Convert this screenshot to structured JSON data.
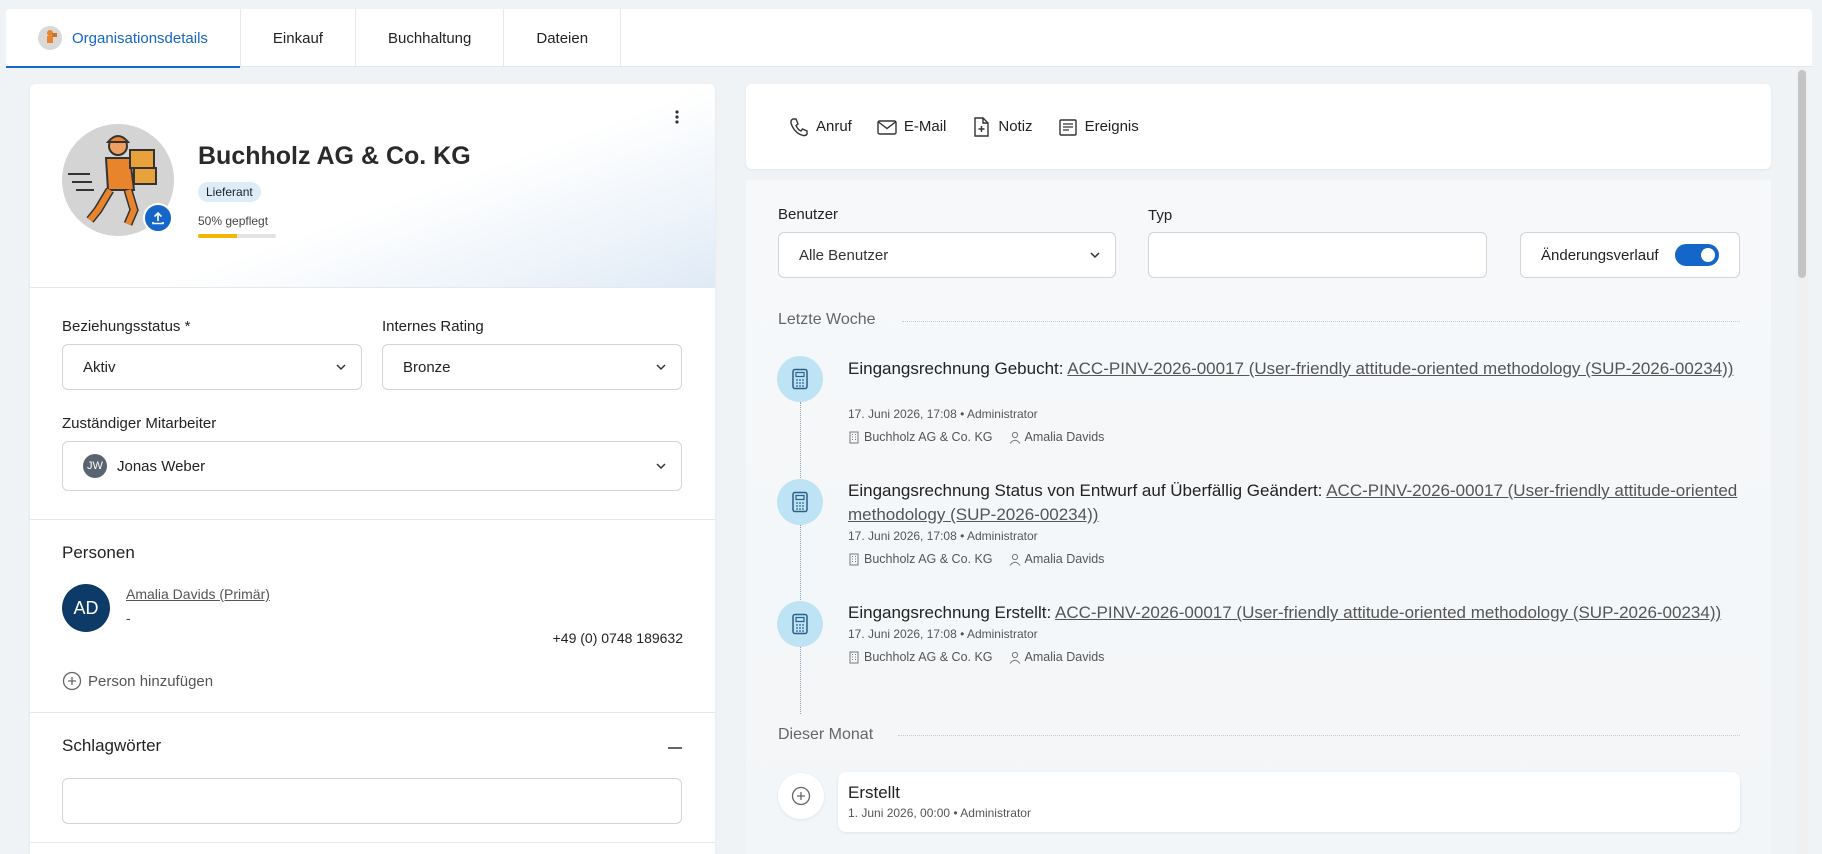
{
  "tabs": [
    {
      "label": "Organisationsdetails"
    },
    {
      "label": "Einkauf"
    },
    {
      "label": "Buchhaltung"
    },
    {
      "label": "Dateien"
    }
  ],
  "org": {
    "name": "Buchholz AG & Co. KG",
    "badge": "Lieferant",
    "care_text": "50% gepflegt",
    "care_fraction": 0.5
  },
  "fields": {
    "relationship_label": "Beziehungsstatus *",
    "relationship_value": "Aktiv",
    "rating_label": "Internes Rating",
    "rating_value": "Bronze",
    "owner_label": "Zuständiger Mitarbeiter",
    "owner_initials": "JW",
    "owner_value": "Jonas Weber"
  },
  "persons": {
    "title": "Personen",
    "initials": "AD",
    "name": "Amalia Davids (Primär)",
    "sub": "-",
    "phone": "+49 (0) 0748 189632",
    "add_label": "Person hinzufügen"
  },
  "tags": {
    "title": "Schlagwörter"
  },
  "actions": [
    {
      "label": "Anruf",
      "icon": "phone-icon"
    },
    {
      "label": "E-Mail",
      "icon": "mail-icon"
    },
    {
      "label": "Notiz",
      "icon": "note-icon"
    },
    {
      "label": "Ereignis",
      "icon": "event-icon"
    }
  ],
  "filters": {
    "user_label": "Benutzer",
    "user_value": "Alle Benutzer",
    "type_label": "Typ",
    "history_label": "Änderungsverlauf"
  },
  "timeline": {
    "group1": "Letzte Woche",
    "group2": "Dieser Monat",
    "entries": [
      {
        "title": "Eingangsrechnung Gebucht:",
        "link": "ACC-PINV-2026-00017 (User-friendly attitude-oriented methodology (SUP-2026-00234))",
        "meta": "17. Juni 2026, 17:08 • Administrator",
        "org": "Buchholz AG & Co. KG",
        "person": "Amalia Davids"
      },
      {
        "title": "Eingangsrechnung Status von Entwurf auf Überfällig Geändert:",
        "link": "ACC-PINV-2026-00017 (User-friendly attitude-oriented methodology (SUP-2026-00234))",
        "meta": "17. Juni 2026, 17:08 • Administrator",
        "org": "Buchholz AG & Co. KG",
        "person": "Amalia Davids"
      },
      {
        "title": "Eingangsrechnung Erstellt:",
        "link": "ACC-PINV-2026-00017 (User-friendly attitude-oriented methodology (SUP-2026-00234))",
        "meta": "17. Juni 2026, 17:08 • Administrator",
        "org": "Buchholz AG & Co. KG",
        "person": "Amalia Davids"
      }
    ],
    "created": {
      "title": "Erstellt",
      "meta": "1. Juni 2026, 00:00 • Administrator"
    }
  },
  "colors": {
    "accent": "#1466c8",
    "badge_bg": "#dcecf8",
    "progress": "#f2b600",
    "timeline_icon_bg": "#bde3f4"
  }
}
